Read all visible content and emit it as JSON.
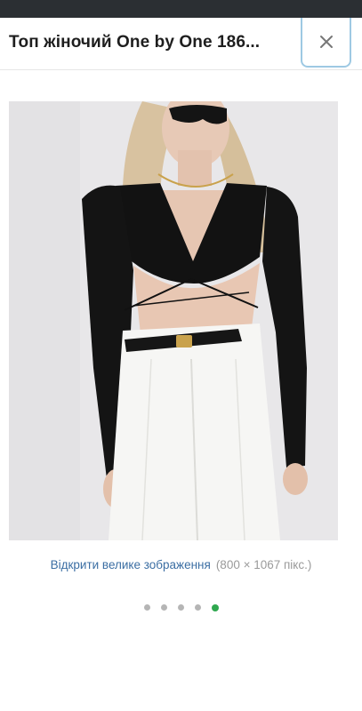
{
  "header": {
    "title": "Топ жіночий One by One 186...",
    "close_icon": "close-icon"
  },
  "image": {
    "open_link": "Відкрити велике зображення",
    "dimensions": "(800 × 1067 пікс.)"
  },
  "carousel": {
    "total": 5,
    "active_index": 4,
    "active_color": "#2fa84f",
    "inactive_color": "#b5b5b5"
  },
  "colors": {
    "status_bar": "#2b2f33",
    "link": "#3b6ea3",
    "close_border": "#9ec9e3"
  }
}
